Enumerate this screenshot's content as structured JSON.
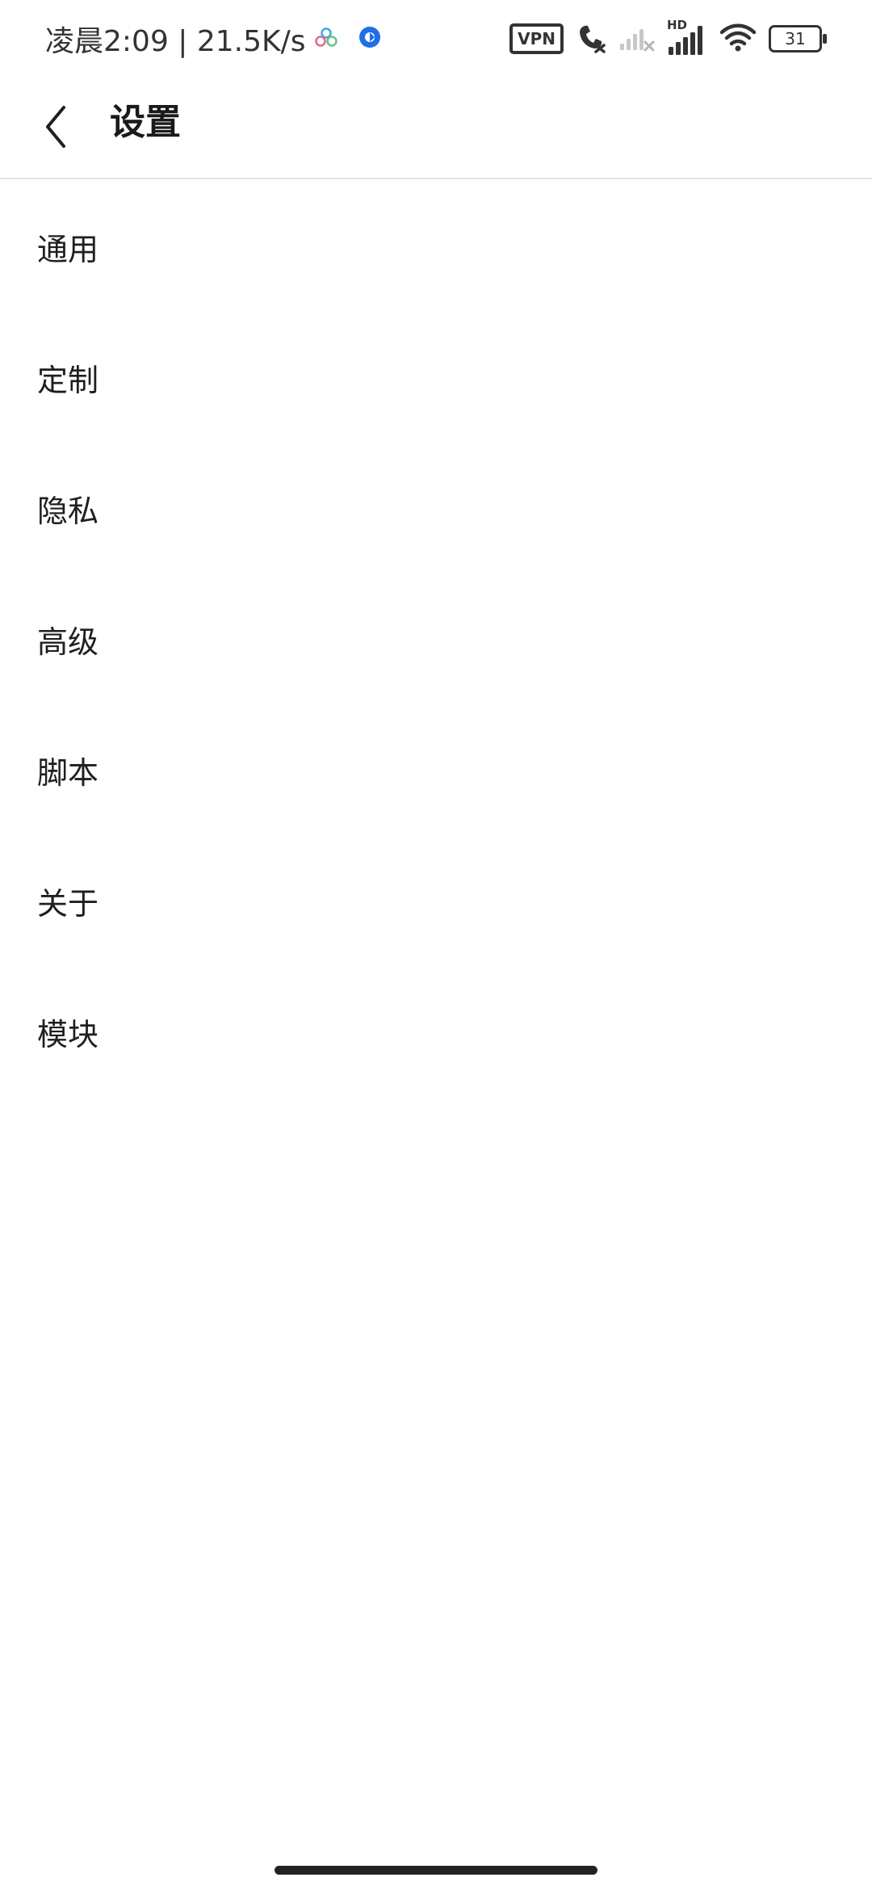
{
  "status_bar": {
    "time_speed": "凌晨2:09 | 21.5K/s",
    "vpn_label": "VPN",
    "network_label": "HD",
    "battery_level": "31",
    "icons": [
      "cluster-app-icon",
      "blue-app-icon",
      "vpn-icon",
      "call-off-icon",
      "no-signal-icon",
      "hd-signal-icon",
      "wifi-icon",
      "battery-icon"
    ],
    "accent_blue": "#1e6fe8",
    "cluster_colors": [
      "#3fa7e0",
      "#e06b8b",
      "#67c38a"
    ]
  },
  "app_bar": {
    "title": "设置",
    "back_icon": "chevron-left-icon"
  },
  "menu": {
    "items": [
      {
        "label": "通用"
      },
      {
        "label": "定制"
      },
      {
        "label": "隐私"
      },
      {
        "label": "高级"
      },
      {
        "label": "脚本"
      },
      {
        "label": "关于"
      },
      {
        "label": "模块"
      }
    ]
  }
}
